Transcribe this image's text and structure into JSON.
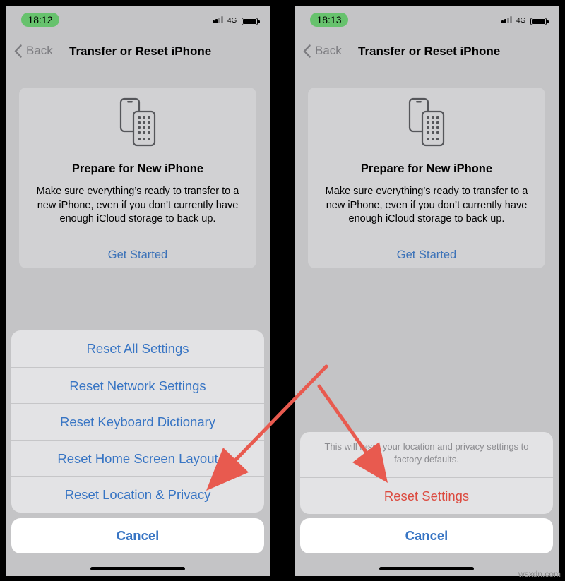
{
  "colors": {
    "screen_background": "#c4c4c6",
    "card_background": "#d1d1d3",
    "ios_blue": "#3875c4",
    "destructive_red": "#dc4a3f",
    "time_pill_green": "#67c26d",
    "annotation_arrow": "#e85a4f"
  },
  "left_screen": {
    "status": {
      "time": "18:12",
      "network": "4G",
      "icons": [
        "signal-icon",
        "battery-icon"
      ]
    },
    "nav": {
      "back_label": "Back",
      "back_icon": "chevron-left-icon",
      "title": "Transfer or Reset iPhone"
    },
    "card": {
      "icon": "two-phones-icon",
      "title": "Prepare for New iPhone",
      "body": "Make sure everything’s ready to transfer to a new iPhone, even if you don’t currently have enough iCloud storage to back up.",
      "link": "Get Started"
    },
    "reset_menu": {
      "items": [
        "Reset All Settings",
        "Reset Network Settings",
        "Reset Keyboard Dictionary",
        "Reset Home Screen Layout",
        "Reset Location & Privacy"
      ],
      "cancel": "Cancel"
    }
  },
  "right_screen": {
    "status": {
      "time": "18:13",
      "network": "4G",
      "icons": [
        "signal-icon",
        "battery-icon"
      ]
    },
    "nav": {
      "back_label": "Back",
      "back_icon": "chevron-left-icon",
      "title": "Transfer or Reset iPhone"
    },
    "card": {
      "icon": "two-phones-icon",
      "title": "Prepare for New iPhone",
      "body": "Make sure everything’s ready to transfer to a new iPhone, even if you don’t currently have enough iCloud storage to back up.",
      "link": "Get Started"
    },
    "confirm_sheet": {
      "message": "This will reset your location and privacy settings to factory defaults.",
      "action": "Reset Settings",
      "cancel": "Cancel"
    }
  },
  "watermark": "wsxdn.com"
}
